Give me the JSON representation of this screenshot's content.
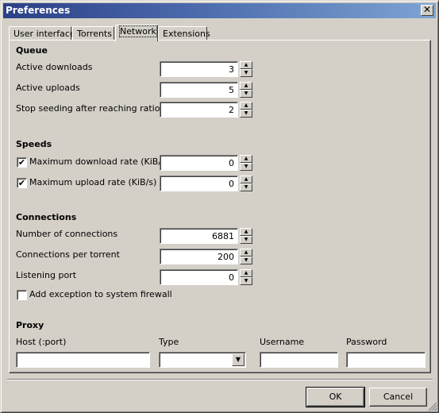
{
  "window": {
    "title": "Preferences",
    "close_icon": "close-icon"
  },
  "tabs": [
    {
      "label": "User interface",
      "active": false
    },
    {
      "label": "Torrents",
      "active": false
    },
    {
      "label": "Network",
      "active": true
    },
    {
      "label": "Extensions",
      "active": false
    }
  ],
  "queue": {
    "title": "Queue",
    "active_downloads": {
      "label": "Active downloads",
      "value": "3"
    },
    "active_uploads": {
      "label": "Active uploads",
      "value": "5"
    },
    "stop_seeding_ratio": {
      "label": "Stop seeding after reaching ratio",
      "value": "2"
    }
  },
  "speeds": {
    "title": "Speeds",
    "max_download": {
      "label": "Maximum download rate (KiB/s)",
      "checked": true,
      "value": "0"
    },
    "max_upload": {
      "label": "Maximum upload rate (KiB/s)",
      "checked": true,
      "value": "0"
    }
  },
  "connections": {
    "title": "Connections",
    "num_connections": {
      "label": "Number of connections",
      "value": "6881"
    },
    "per_torrent": {
      "label": "Connections per torrent",
      "value": "200"
    },
    "listening_port": {
      "label": "Listening port",
      "value": "0"
    },
    "firewall_exception": {
      "label": "Add exception to system firewall",
      "checked": false
    }
  },
  "proxy": {
    "title": "Proxy",
    "host_label": "Host (:port)",
    "host_value": "",
    "type_label": "Type",
    "type_value": "",
    "username_label": "Username",
    "username_value": "",
    "password_label": "Password",
    "password_value": ""
  },
  "buttons": {
    "ok": "OK",
    "cancel": "Cancel"
  },
  "glyphs": {
    "spin_up": "▲",
    "spin_down": "▼",
    "check": "✔",
    "unchecked": "",
    "combo_arrow": "▼",
    "close": "✕"
  }
}
